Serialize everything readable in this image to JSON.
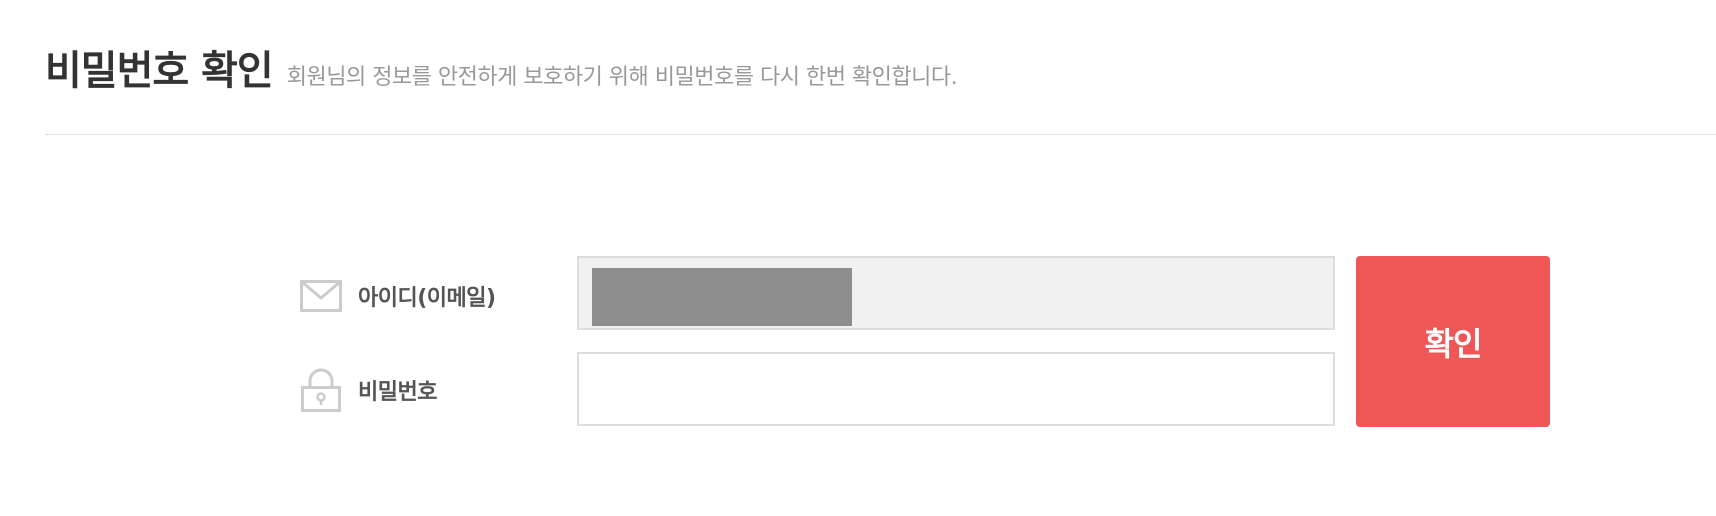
{
  "header": {
    "title": "비밀번호 확인",
    "subtitle": "회원님의 정보를 안전하게 보호하기 위해 비밀번호를 다시 한번 확인합니다."
  },
  "form": {
    "email": {
      "label": "아이디(이메일)",
      "icon": "envelope-icon",
      "value": "",
      "masked": true
    },
    "password": {
      "label": "비밀번호",
      "icon": "lock-icon",
      "value": ""
    },
    "confirm_label": "확인"
  },
  "colors": {
    "accent": "#ef5656",
    "icon_gray": "#cccccc",
    "readonly_bg": "#f1f1f1",
    "mask_gray": "#8e8e8e"
  }
}
